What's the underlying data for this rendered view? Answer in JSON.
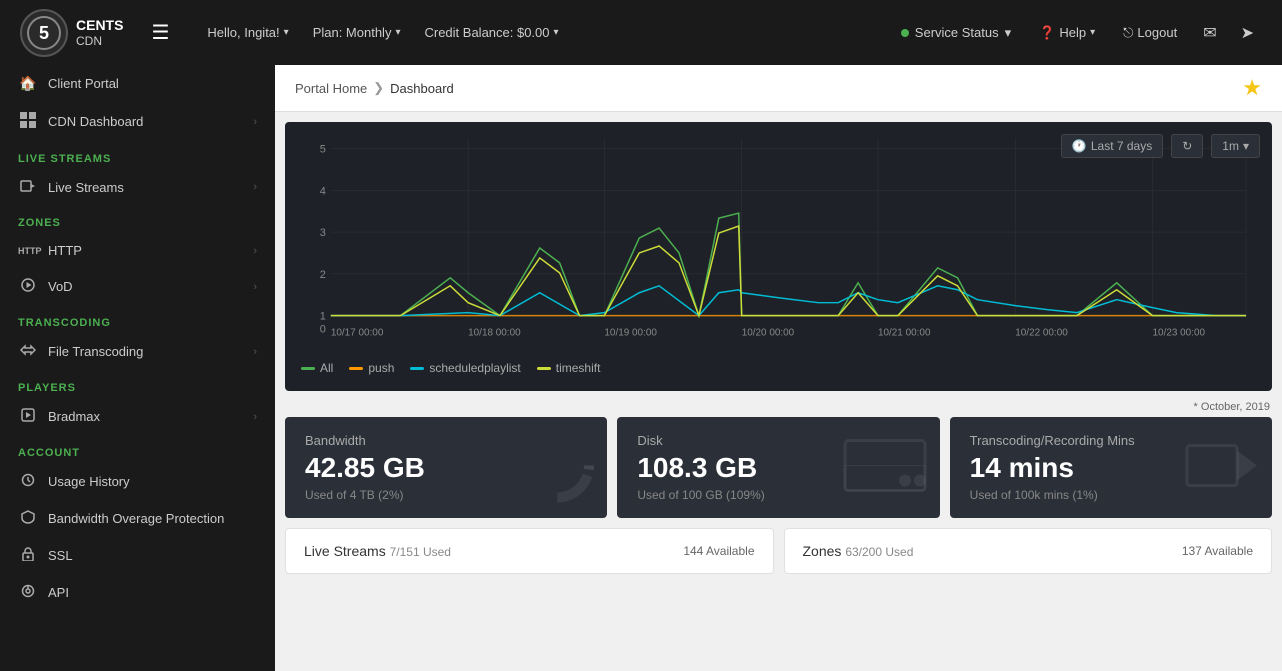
{
  "topbar": {
    "logo_letter": "5",
    "logo_cents": "CENTS",
    "logo_cdn": "CDN",
    "greeting": "Hello, Ingita!",
    "plan_label": "Plan: Monthly",
    "credit_label": "Credit Balance: $0.00",
    "service_status_label": "Service Status",
    "help_label": "Help",
    "logout_label": "Logout"
  },
  "breadcrumb": {
    "home": "Portal Home",
    "current": "Dashboard",
    "arrow": "❯"
  },
  "sidebar": {
    "top_item": "Client Portal",
    "sections": [
      {
        "label": "",
        "items": [
          {
            "id": "client-portal",
            "icon": "🏠",
            "text": "Client Portal",
            "arrow": true
          },
          {
            "id": "cdn-dashboard",
            "icon": "📊",
            "text": "CDN Dashboard",
            "arrow": true
          }
        ]
      },
      {
        "label": "LIVE STREAMS",
        "items": [
          {
            "id": "live-streams",
            "icon": "🎬",
            "text": "Live Streams",
            "arrow": true
          }
        ]
      },
      {
        "label": "ZONES",
        "items": [
          {
            "id": "http",
            "icon": "HTTP",
            "text": "HTTP",
            "arrow": true
          },
          {
            "id": "vod",
            "icon": "▶",
            "text": "VoD",
            "arrow": true
          }
        ]
      },
      {
        "label": "TRANSCODING",
        "items": [
          {
            "id": "file-transcoding",
            "icon": "✂",
            "text": "File Transcoding",
            "arrow": true
          }
        ]
      },
      {
        "label": "PLAYERS",
        "items": [
          {
            "id": "bradmax",
            "icon": "🎬",
            "text": "Bradmax",
            "arrow": true
          }
        ]
      },
      {
        "label": "ACCOUNT",
        "items": [
          {
            "id": "usage-history",
            "icon": "⏱",
            "text": "Usage History",
            "arrow": false
          },
          {
            "id": "bandwidth-protection",
            "icon": "🛡",
            "text": "Bandwidth Overage Protection",
            "arrow": false
          },
          {
            "id": "ssl",
            "icon": "🔒",
            "text": "SSL",
            "arrow": false
          },
          {
            "id": "api",
            "icon": "⚙",
            "text": "API",
            "arrow": false
          }
        ]
      }
    ]
  },
  "chart": {
    "time_range": "Last 7 days",
    "interval": "1m",
    "y_labels": [
      "5",
      "4",
      "3",
      "2",
      "1",
      "0"
    ],
    "x_labels": [
      "10/17 00:00",
      "10/18 00:00",
      "10/19 00:00",
      "10/20 00:00",
      "10/21 00:00",
      "10/22 00:00",
      "10/23 00:00"
    ],
    "legend": [
      {
        "label": "All",
        "color": "#4caf50"
      },
      {
        "label": "push",
        "color": "#ff9800"
      },
      {
        "label": "scheduledplaylist",
        "color": "#00bcd4"
      },
      {
        "label": "timeshift",
        "color": "#cddc39"
      }
    ]
  },
  "stats": {
    "october_note": "* October, 2019",
    "cards": [
      {
        "id": "bandwidth",
        "label": "Bandwidth",
        "value": "42.85 GB",
        "sub": "Used of 4 TB (2%)"
      },
      {
        "id": "disk",
        "label": "Disk",
        "value": "108.3 GB",
        "sub": "Used of 100 GB (109%)"
      },
      {
        "id": "transcoding",
        "label": "Transcoding/Recording Mins",
        "value": "14 mins",
        "sub": "Used of 100k mins (1%)"
      }
    ]
  },
  "bottom_cards": [
    {
      "id": "live-streams-card",
      "title": "Live Streams",
      "usage": "7/151 Used",
      "available": "144 Available"
    },
    {
      "id": "zones-card",
      "title": "Zones",
      "usage": "63/200 Used",
      "available": "137 Available"
    }
  ]
}
